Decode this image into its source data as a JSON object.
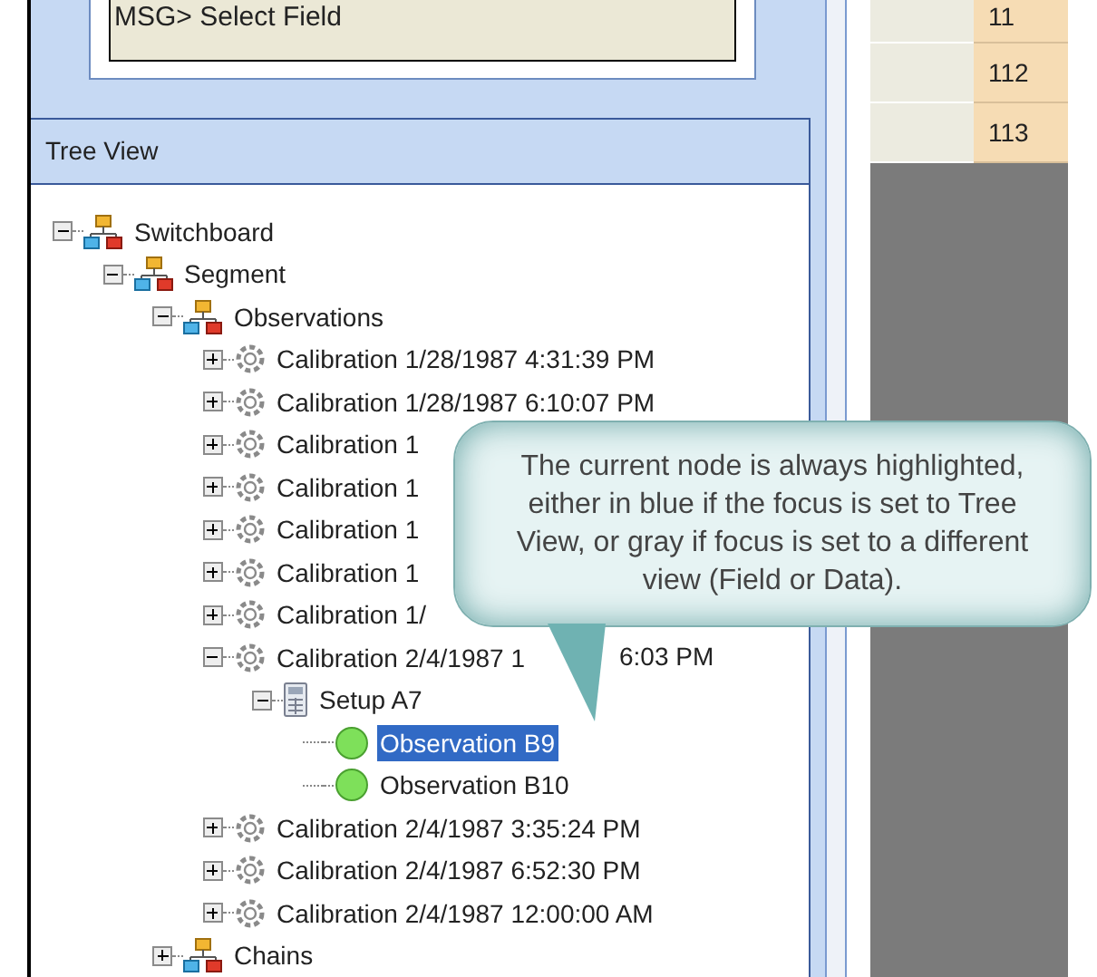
{
  "message_field": {
    "value": "MSG> Select Field"
  },
  "tree_view": {
    "title": "Tree View",
    "nodes": [
      {
        "label": "Switchboard",
        "kind": "network",
        "expanded": true,
        "selected": false,
        "children": [
          {
            "label": "Segment",
            "kind": "network",
            "expanded": true,
            "selected": false,
            "children": [
              {
                "label": "Observations",
                "kind": "network",
                "expanded": true,
                "selected": false,
                "children": [
                  {
                    "label": "Calibration 1/28/1987 4:31:39 PM",
                    "kind": "gear",
                    "expanded": false,
                    "selected": false
                  },
                  {
                    "label": "Calibration 1/28/1987 6:10:07 PM",
                    "kind": "gear",
                    "expanded": false,
                    "selected": false
                  },
                  {
                    "label": "Calibration 1",
                    "kind": "gear",
                    "expanded": false,
                    "selected": false
                  },
                  {
                    "label": "Calibration 1",
                    "kind": "gear",
                    "expanded": false,
                    "selected": false
                  },
                  {
                    "label": "Calibration 1",
                    "kind": "gear",
                    "expanded": false,
                    "selected": false
                  },
                  {
                    "label": "Calibration 1",
                    "kind": "gear",
                    "expanded": false,
                    "selected": false
                  },
                  {
                    "label": "Calibration 1/",
                    "kind": "gear",
                    "expanded": false,
                    "selected": false
                  },
                  {
                    "label": "Calibration 2/4/1987 1",
                    "label_tail": "6:03 PM",
                    "kind": "gear",
                    "expanded": true,
                    "selected": false,
                    "children": [
                      {
                        "label": "Setup A7",
                        "kind": "setup",
                        "expanded": true,
                        "selected": false,
                        "children": [
                          {
                            "label": "Observation B9",
                            "kind": "observation",
                            "selected": true
                          },
                          {
                            "label": "Observation B10",
                            "kind": "observation",
                            "selected": false
                          }
                        ]
                      }
                    ]
                  },
                  {
                    "label": "Calibration 2/4/1987 3:35:24 PM",
                    "kind": "gear",
                    "expanded": false,
                    "selected": false
                  },
                  {
                    "label": "Calibration 2/4/1987 6:52:30 PM",
                    "kind": "gear",
                    "expanded": false,
                    "selected": false
                  },
                  {
                    "label": "Calibration 2/4/1987 12:00:00 AM",
                    "kind": "gear",
                    "expanded": false,
                    "selected": false
                  }
                ]
              },
              {
                "label": "Chains",
                "kind": "network",
                "expanded": false,
                "selected": false
              }
            ]
          }
        ]
      }
    ]
  },
  "data_grid": {
    "rows": [
      "11",
      "112",
      "113"
    ]
  },
  "callout": {
    "text": "The current node is always highlighted, either in blue if the focus is set to Tree View, or gray if focus is set to a different view (Field or Data)."
  }
}
